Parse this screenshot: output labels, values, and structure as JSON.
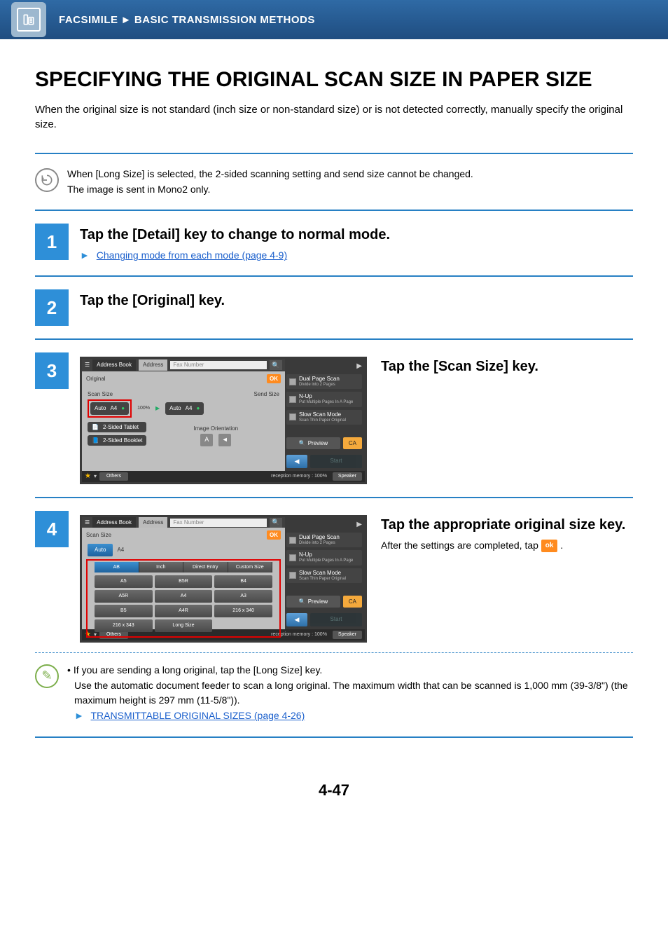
{
  "header": {
    "section": "FACSIMILE",
    "subsection": "BASIC TRANSMISSION METHODS"
  },
  "title": "SPECIFYING THE ORIGINAL SCAN SIZE IN PAPER SIZE",
  "intro": "When the original size is not standard (inch size or non-standard size) or is not detected correctly, manually specify the original size.",
  "note": {
    "line1": "When [Long Size] is selected, the 2-sided scanning setting and send size cannot be changed.",
    "line2": "The image is sent in Mono2 only."
  },
  "steps": {
    "s1": {
      "num": "1",
      "title": "Tap the [Detail] key to change to normal mode.",
      "link": "Changing mode from each mode (page 4-9)"
    },
    "s2": {
      "num": "2",
      "title": "Tap the [Original] key."
    },
    "s3": {
      "num": "3",
      "title": "Tap the [Scan Size] key."
    },
    "s4": {
      "num": "4",
      "title": "Tap the appropriate original size key.",
      "after_prefix": "After the settings are completed, tap ",
      "after_suffix": "."
    }
  },
  "sim3": {
    "tabs": {
      "addressbook": "Address Book",
      "address": "Address"
    },
    "fax_placeholder": "Fax Number",
    "panel_title": "Original",
    "scan_label": "Scan Size",
    "send_label": "Send Size",
    "percent": "100%",
    "auto": "Auto",
    "a4": "A4",
    "tablet": "2-Sided Tablet",
    "booklet": "2-Sided Booklet",
    "image_orientation": "Image Orientation",
    "ok": "OK",
    "right": {
      "dual": "Dual Page Scan",
      "dual_sub": "Divide into 2 Pages",
      "nup": "N-Up",
      "nup_sub": "Put Multiple Pages In A Page",
      "slow": "Slow Scan Mode",
      "slow_sub": "Scan Thin Paper Original"
    },
    "preview": "Preview",
    "ca": "CA",
    "start": "Start",
    "others": "Others",
    "reception": "reception memory :   100%",
    "speaker": "Speaker"
  },
  "sim4": {
    "panel_title": "Scan Size",
    "auto": "Auto",
    "a4": "A4",
    "tabs": {
      "ab": "AB",
      "inch": "Inch",
      "direct": "Direct Entry",
      "custom": "Custom Size"
    },
    "sizes": {
      "a5": "A5",
      "b5r": "B5R",
      "b4": "B4",
      "a5r": "A5R",
      "a4v": "A4",
      "a3": "A3",
      "b5": "B5",
      "a4r": "A4R",
      "s216": "216 x 340",
      "s216b": "216 x 343",
      "long": "Long Size"
    }
  },
  "tip": {
    "line1": "If you are sending a long original, tap the [Long Size] key.",
    "line2": "Use the automatic document feeder to scan a long original. The maximum width that can be scanned is 1,000 mm (39-3/8\") (the maximum height is 297 mm (11-5/8\")).",
    "link": "TRANSMITTABLE ORIGINAL SIZES (page 4-26)"
  },
  "page_number": "4-47",
  "ok_label": "ok"
}
